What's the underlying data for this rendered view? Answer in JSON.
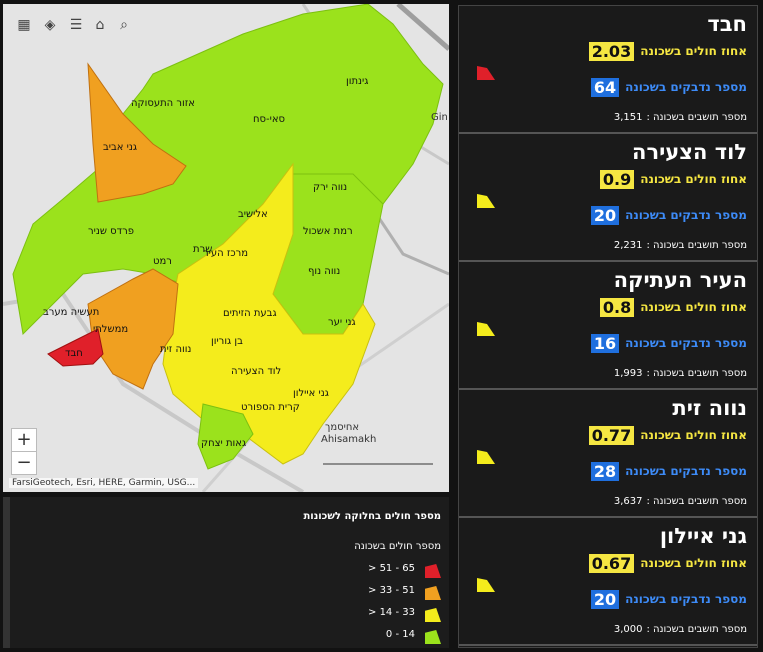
{
  "map": {
    "tools": [
      {
        "name": "grid-icon",
        "glyph": "▦"
      },
      {
        "name": "layers-icon",
        "glyph": "◈"
      },
      {
        "name": "list-icon",
        "glyph": "☰"
      },
      {
        "name": "home-icon",
        "glyph": "⌂"
      },
      {
        "name": "search-icon",
        "glyph": "⌕"
      }
    ],
    "zoom_in": "+",
    "zoom_out": "−",
    "attribution": "FarsiGeotech, Esri, HERE, Garmin, USG...",
    "neighborhoods": [
      "גינתון",
      "אזור התעסוקה",
      "סאי-סח",
      "גני אביב",
      "נווה ירק",
      "אלישיב",
      "רמת אשכול",
      "פרדס שניר",
      "שרת",
      "רמט",
      "מרכז העיר",
      "נווה נוף",
      "תעשיה מערב",
      "ממשלתי",
      "גבעת הזיתים",
      "גני יער",
      "חבד",
      "נווה זית",
      "בן גוריון",
      "לוד הצעירה",
      "גני איילון",
      "קרית הספורט",
      "גאות יצחק"
    ],
    "places": {
      "ahisamakh_he": "אחיסמך",
      "ahisamakh_en": "Ahisamakh",
      "gin": "Gin"
    },
    "colors": {
      "red": "#e0202a",
      "orange": "#f0a020",
      "yellow": "#f4ec1c",
      "green": "#9be21c"
    }
  },
  "legend": {
    "title": "מספר חולים בחלוקה לשכונות",
    "subtitle": "מספר חולים בשכונה",
    "items": [
      {
        "label": "65 - 51 <",
        "color": "#e0202a"
      },
      {
        "label": "51 - 33 <",
        "color": "#f0a020"
      },
      {
        "label": "33 - 14 <",
        "color": "#f4ec1c"
      },
      {
        "label": "14 - 0",
        "color": "#9be21c"
      }
    ]
  },
  "cards": [
    {
      "name": "חבד",
      "sick_label": "אחוז חולים בשכונה",
      "sick": "2.03",
      "infected_label": "מספר נדבקים בשכונה",
      "infected": "64",
      "residents_label": "מספר תושבים בשכונה :",
      "residents": "3,151",
      "flag_color": "#e0202a"
    },
    {
      "name": "לוד הצעירה",
      "sick_label": "אחוז חולים בשכונה",
      "sick": "0.9",
      "infected_label": "מספר נדבקים בשכונה",
      "infected": "20",
      "residents_label": "מספר תושבים בשכונה :",
      "residents": "2,231",
      "flag_color": "#f4ec1c"
    },
    {
      "name": "העיר העתיקה",
      "sick_label": "אחוז חולים בשכונה",
      "sick": "0.8",
      "infected_label": "מספר נדבקים בשכונה",
      "infected": "16",
      "residents_label": "מספר תושבים בשכונה :",
      "residents": "1,993",
      "flag_color": "#f4ec1c"
    },
    {
      "name": "נווה זית",
      "sick_label": "אחוז חולים בשכונה",
      "sick": "0.77",
      "infected_label": "מספר נדבקים בשכונה",
      "infected": "28",
      "residents_label": "מספר תושבים בשכונה :",
      "residents": "3,637",
      "flag_color": "#f4ec1c"
    },
    {
      "name": "גני איילון",
      "sick_label": "אחוז חולים בשכונה",
      "sick": "0.67",
      "infected_label": "מספר נדבקים בשכונה",
      "infected": "20",
      "residents_label": "מספר תושבים בשכונה :",
      "residents": "3,000",
      "flag_color": "#f4ec1c"
    }
  ]
}
